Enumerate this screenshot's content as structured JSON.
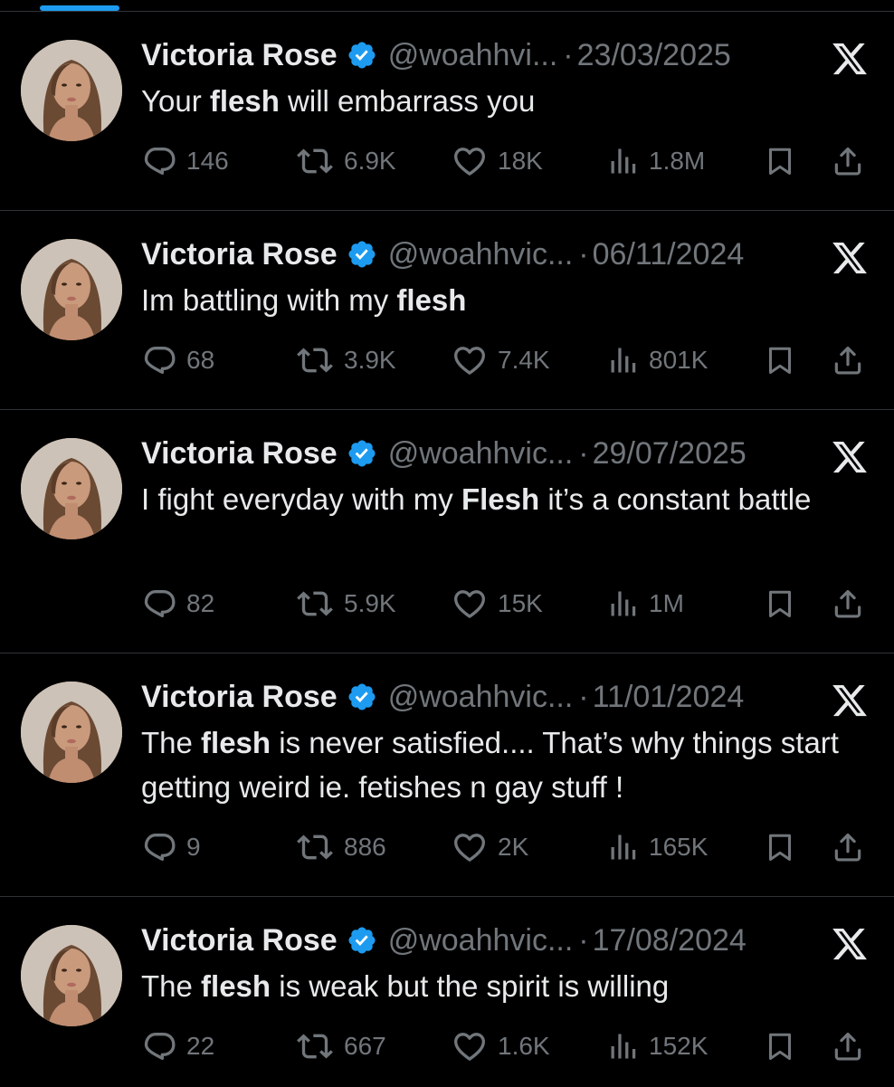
{
  "colors": {
    "background": "#000000",
    "text": "#e7e9ea",
    "secondary": "#71767b",
    "divider": "#2f3336",
    "verified": "#1d9bf0"
  },
  "icons": [
    "verified-badge-icon",
    "x-logo-icon",
    "reply-icon",
    "retweet-icon",
    "like-icon",
    "views-icon",
    "bookmark-icon",
    "share-icon"
  ],
  "tweets": [
    {
      "name": "Victoria Rose",
      "handle": "@woahhvi...",
      "separator": "·",
      "date": "23/03/2025",
      "text": {
        "before": "Your ",
        "bold": "flesh",
        "after": " will embarrass you"
      },
      "replies": "146",
      "retweets": "6.9K",
      "likes": "18K",
      "views": "1.8M"
    },
    {
      "name": "Victoria Rose",
      "handle": "@woahhvic...",
      "separator": "·",
      "date": "06/11/2024",
      "text": {
        "before": "Im battling with my ",
        "bold": "flesh",
        "after": ""
      },
      "replies": "68",
      "retweets": "3.9K",
      "likes": "7.4K",
      "views": "801K"
    },
    {
      "name": "Victoria Rose",
      "handle": "@woahhvic...",
      "separator": "·",
      "date": "29/07/2025",
      "text": {
        "before": "I fight everyday with my ",
        "bold": "Flesh",
        "after": " it’s a constant battle"
      },
      "replies": "82",
      "retweets": "5.9K",
      "likes": "15K",
      "views": "1M"
    },
    {
      "name": "Victoria Rose",
      "handle": "@woahhvic...",
      "separator": "·",
      "date": "11/01/2024",
      "text": {
        "before": "The ",
        "bold": "flesh",
        "after": " is never satisfied.... That’s why things start getting weird ie. fetishes n gay stuff !"
      },
      "replies": "9",
      "retweets": "886",
      "likes": "2K",
      "views": "165K"
    },
    {
      "name": "Victoria Rose",
      "handle": "@woahhvic...",
      "separator": "·",
      "date": "17/08/2024",
      "text": {
        "before": "The ",
        "bold": "flesh",
        "after": " is weak but the spirit is willing"
      },
      "replies": "22",
      "retweets": "667",
      "likes": "1.6K",
      "views": "152K"
    }
  ]
}
